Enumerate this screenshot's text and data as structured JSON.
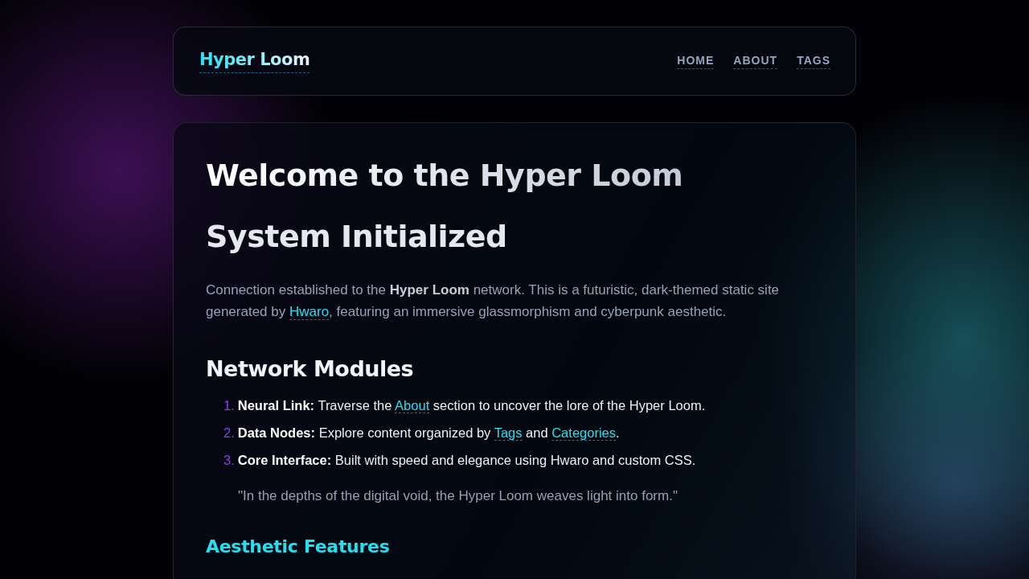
{
  "header": {
    "logo": "Hyper Loom",
    "nav": [
      {
        "label": "HOME"
      },
      {
        "label": "ABOUT"
      },
      {
        "label": "TAGS"
      }
    ]
  },
  "content": {
    "title": "Welcome to the Hyper Loom",
    "subtitle": "System Initialized",
    "intro": [
      {
        "kind": "text",
        "text": "Connection established to the **Hyper Loom** network. This is a futuristic, dark-themed static site generated by "
      },
      {
        "kind": "link",
        "text": "Hwaro"
      },
      {
        "kind": "text",
        "text": ", featuring an immersive glassmorphism and cyberpunk aesthetic."
      }
    ],
    "section_heading": "Network Modules",
    "modules": [
      {
        "number": "1.",
        "parts": [
          {
            "kind": "text",
            "text": "**Neural Link:** Traverse the "
          },
          {
            "kind": "link",
            "text": "About"
          },
          {
            "kind": "text",
            "text": " section to uncover the lore of the Hyper Loom."
          }
        ]
      },
      {
        "number": "2.",
        "parts": [
          {
            "kind": "text",
            "text": "**Data Nodes:** Explore content organized by "
          },
          {
            "kind": "link",
            "text": "Tags"
          },
          {
            "kind": "text",
            "text": " and "
          },
          {
            "kind": "link",
            "text": "Categories"
          },
          {
            "kind": "text",
            "text": "."
          }
        ]
      },
      {
        "number": "3.",
        "parts": [
          {
            "kind": "text",
            "text": "**Core Interface:** Built with speed and elegance using Hwaro and custom CSS."
          }
        ]
      }
    ],
    "quote": "\"In the depths of the digital void, the Hyper Loom weaves light into form.\"",
    "features_heading": "Aesthetic Features"
  }
}
